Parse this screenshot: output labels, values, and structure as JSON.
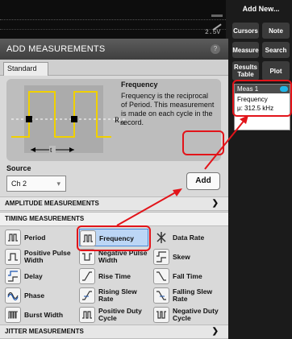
{
  "scope": {
    "readout": "2.5V"
  },
  "dialog": {
    "title": "ADD MEASUREMENTS",
    "help": "?",
    "tab": "Standard",
    "preview": {
      "name": "Frequency",
      "description": "Frequency is the reciprocal of Period. This measurement is made on each cycle in the record.",
      "ref_label": "R",
      "ref_sub": "M",
      "t_label": "t"
    },
    "source": {
      "label": "Source",
      "value": "Ch 2"
    },
    "add_label": "Add",
    "sections": {
      "amplitude": "AMPLITUDE MEASUREMENTS",
      "timing": "TIMING MEASUREMENTS",
      "jitter": "JITTER MEASUREMENTS"
    },
    "timing_items": [
      {
        "label": "Period"
      },
      {
        "label": "Frequency"
      },
      {
        "label": "Data Rate"
      },
      {
        "label": "Positive Pulse Width"
      },
      {
        "label": "Negative Pulse Width"
      },
      {
        "label": "Skew"
      },
      {
        "label": "Delay"
      },
      {
        "label": "Rise Time"
      },
      {
        "label": "Fall Time"
      },
      {
        "label": "Phase"
      },
      {
        "label": "Rising Slew Rate"
      },
      {
        "label": "Falling Slew Rate"
      },
      {
        "label": "Burst Width"
      },
      {
        "label": "Positive Duty Cycle"
      },
      {
        "label": "Negative Duty Cycle"
      }
    ],
    "selected_item": "Frequency"
  },
  "right_panel": {
    "title": "Add New...",
    "buttons": {
      "cursors": "Cursors",
      "note": "Note",
      "measure": "Measure",
      "search": "Search",
      "results": "Results Table",
      "plot": "Plot"
    },
    "badge": {
      "title": "Meas 1",
      "measurement": "Frequency",
      "value": "μ: 312.5 kHz"
    }
  },
  "colors": {
    "highlight": "#e2141a",
    "waveform": "#f0d000",
    "selected_bg": "#bcd6f5",
    "badge_dot": "#1fb6e8"
  }
}
